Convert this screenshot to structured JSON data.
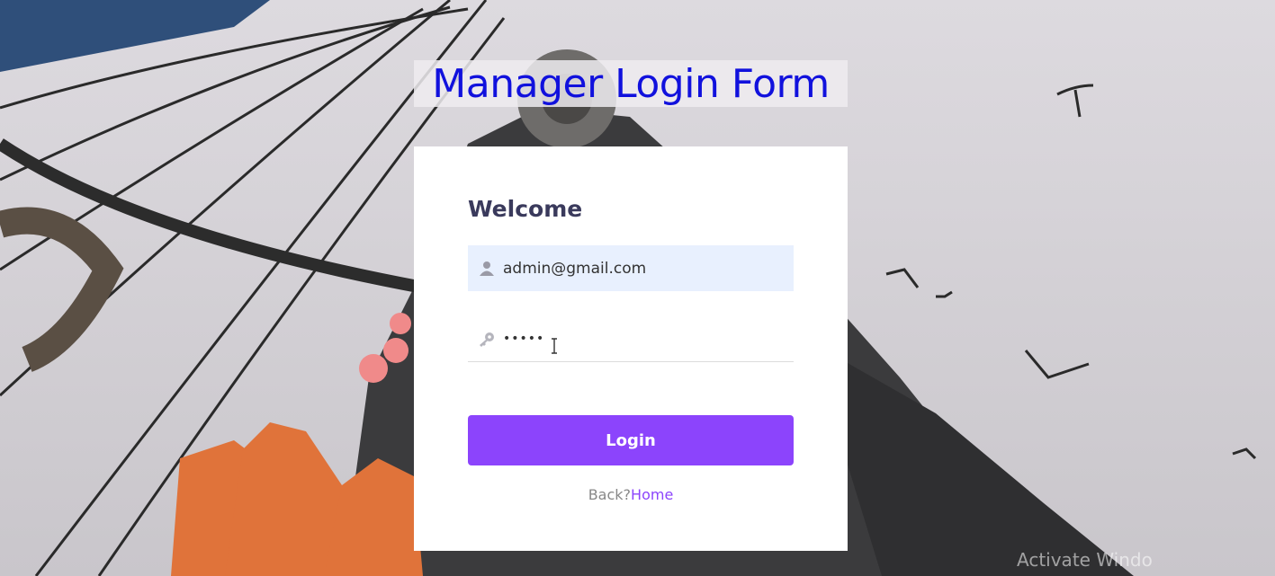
{
  "page": {
    "title": "Manager Login Form"
  },
  "form": {
    "heading": "Welcome",
    "email": {
      "value": "admin@gmail.com",
      "icon": "user-icon"
    },
    "password": {
      "value": "•••••",
      "icon": "key-icon"
    },
    "login_label": "Login",
    "back_prefix": "Back?",
    "home_link": "Home"
  },
  "watermark": "Activate Windo",
  "colors": {
    "title": "#1111dd",
    "accent": "#8c44fc",
    "heading": "#3a3a5c",
    "email_fill": "#e8f0fe"
  }
}
